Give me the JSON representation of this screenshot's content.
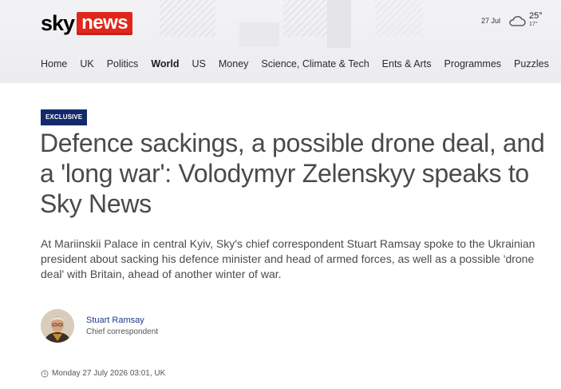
{
  "brand": {
    "sky": "sky",
    "news": "news",
    "accent": "#e1261c"
  },
  "weather": {
    "date": "27 Jul",
    "icon": "cloud-icon",
    "high": "25°",
    "low": "17°"
  },
  "nav": {
    "items": [
      {
        "label": "Home",
        "active": false
      },
      {
        "label": "UK",
        "active": false
      },
      {
        "label": "Politics",
        "active": false
      },
      {
        "label": "World",
        "active": true
      },
      {
        "label": "US",
        "active": false
      },
      {
        "label": "Money",
        "active": false
      },
      {
        "label": "Science, Climate & Tech",
        "active": false
      },
      {
        "label": "Ents & Arts",
        "active": false
      },
      {
        "label": "Programmes",
        "active": false
      },
      {
        "label": "Puzzles",
        "active": false
      }
    ]
  },
  "article": {
    "badge": "EXCLUSIVE",
    "headline": "Defence sackings, a possible drone deal, and a 'long war': Volodymyr Zelenskyy speaks to Sky News",
    "standfirst": "At Mariinskii Palace in central Kyiv, Sky's chief correspondent Stuart Ramsay spoke to the Ukrainian president about sacking his defence minister and head of armed forces, as well as a possible 'drone deal' with Britain, ahead of another winter of war.",
    "author": {
      "name": "Stuart Ramsay",
      "role": "Chief correspondent"
    },
    "timestamp": "Monday 27 July 2026 03:01, UK"
  },
  "colors": {
    "badge_bg": "#13296b",
    "author_link": "#1b3a8a"
  }
}
